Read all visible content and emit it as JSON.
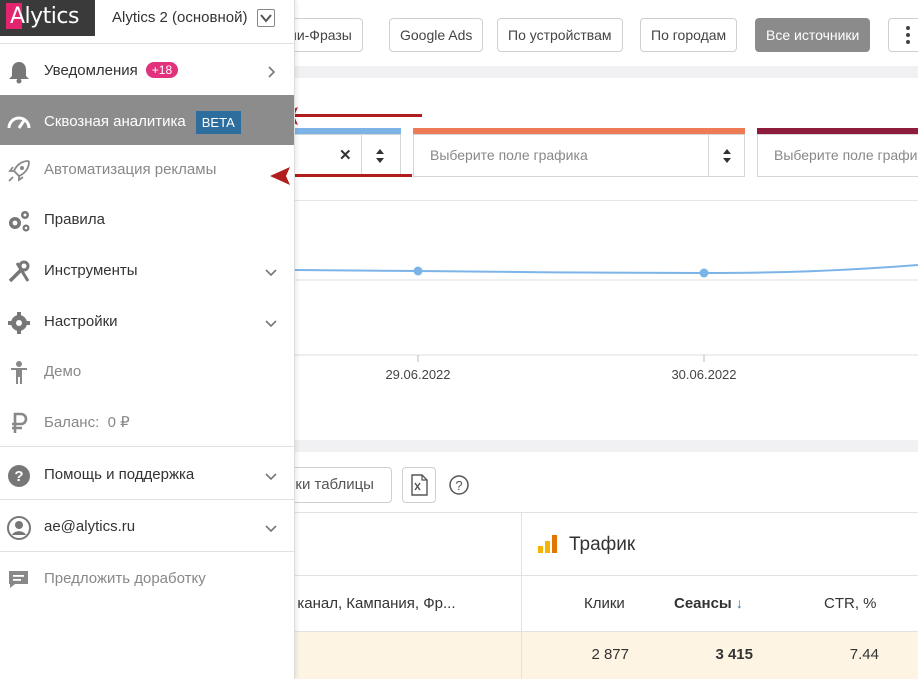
{
  "app": {
    "logo_text": "Alytics",
    "account_name": "Alytics 2 (основной)"
  },
  "sidebar": {
    "items": [
      {
        "label": "Уведомления",
        "badge": "+18",
        "icon": "bell-icon"
      },
      {
        "label": "Сквозная аналитика",
        "badge": "BETA",
        "icon": "speedometer-icon"
      },
      {
        "label": "Автоматизация рекламы",
        "icon": "rocket-icon"
      },
      {
        "label": "Правила",
        "icon": "gears-icon"
      },
      {
        "label": "Инструменты",
        "icon": "tools-icon"
      },
      {
        "label": "Настройки",
        "icon": "gear-icon"
      },
      {
        "label": "Демо",
        "icon": "person-icon"
      },
      {
        "label": "Баланс:",
        "value": "0 ₽",
        "icon": "ruble-icon"
      },
      {
        "label": "Помощь и поддержка",
        "icon": "help-icon"
      },
      {
        "label": "ae@alytics.ru",
        "icon": "user-icon"
      },
      {
        "label": "Предложить доработку",
        "icon": "comment-icon"
      }
    ]
  },
  "toolbar": {
    "tabs": [
      "ии-Фразы",
      "Google Ads",
      "По устройствам",
      "По городам",
      "Все источники"
    ],
    "active_tab": "Все источники"
  },
  "chart_controls": {
    "select2_placeholder": "Выберите поле графика",
    "select3_placeholder": "Выберите поле графи",
    "colors": {
      "series1": "#7db4e8",
      "series2": "#ef7b56",
      "series3": "#8e1c3c"
    }
  },
  "chart_data": {
    "type": "line",
    "x": [
      "29.06.2022",
      "30.06.2022"
    ],
    "tick_labels": [
      "29.06.2022",
      "30.06.2022"
    ]
  },
  "table_tools": {
    "settings_label": "йки таблицы"
  },
  "table": {
    "group_title": "Трафик",
    "dimension_header": "/ канал, Кампания, Фр...",
    "columns": [
      "Клики",
      "Сеансы",
      "CTR, %"
    ],
    "sorted_column_arrow": "↓",
    "row": {
      "clicks": "2 877",
      "sessions": "3 415",
      "ctr": "7.44"
    }
  }
}
